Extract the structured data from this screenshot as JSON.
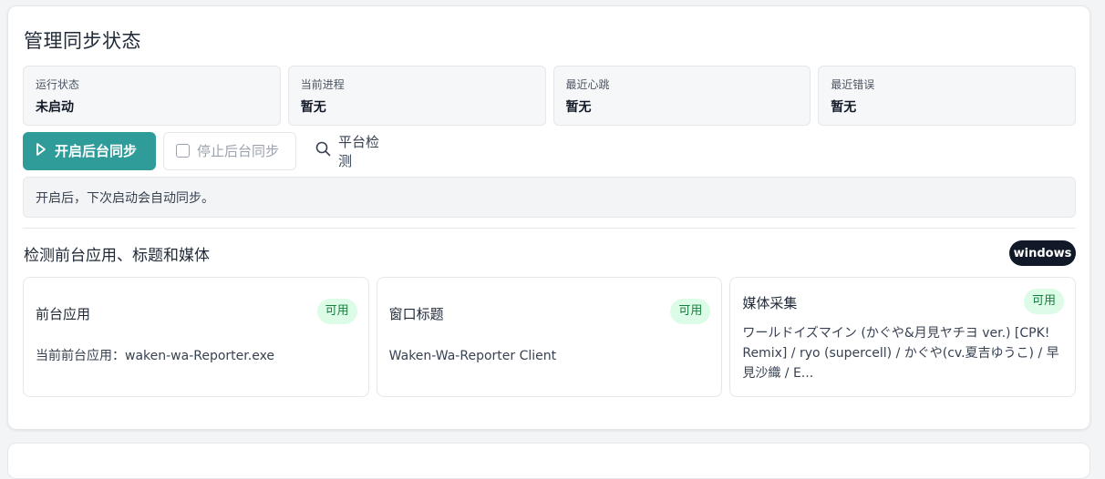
{
  "page": {
    "title": "管理同步状态"
  },
  "stats": [
    {
      "label": "运行状态",
      "value": "未启动"
    },
    {
      "label": "当前进程",
      "value": "暂无"
    },
    {
      "label": "最近心跳",
      "value": "暂无"
    },
    {
      "label": "最近错误",
      "value": "暂无"
    }
  ],
  "actions": {
    "start_label": "开启后台同步",
    "stop_label": "停止后台同步",
    "detect_label": "平台检测"
  },
  "info": {
    "text": "开启后，下次启动会自动同步。"
  },
  "detection": {
    "title": "检测前台应用、标题和媒体",
    "platform": "windows",
    "features": [
      {
        "name": "前台应用",
        "status": "可用",
        "detail": "当前前台应用：waken-wa-Reporter.exe"
      },
      {
        "name": "窗口标题",
        "status": "可用",
        "detail": "Waken-Wa-Reporter Client"
      },
      {
        "name": "媒体采集",
        "status": "可用",
        "detail": "ワールドイズマイン (かぐや&月見ヤチヨ ver.) [CPK! Remix] / ryo (supercell) / かぐや(cv.夏吉ゆうこ) / 早見沙織 / E..."
      }
    ]
  },
  "colors": {
    "primary": "#2f9c99",
    "badge_bg": "#dcfce7",
    "badge_text": "#15803d",
    "platform_bg": "#111827"
  },
  "icons": {
    "start": "play-icon",
    "stop": "checkbox-icon",
    "detect": "search-icon"
  }
}
